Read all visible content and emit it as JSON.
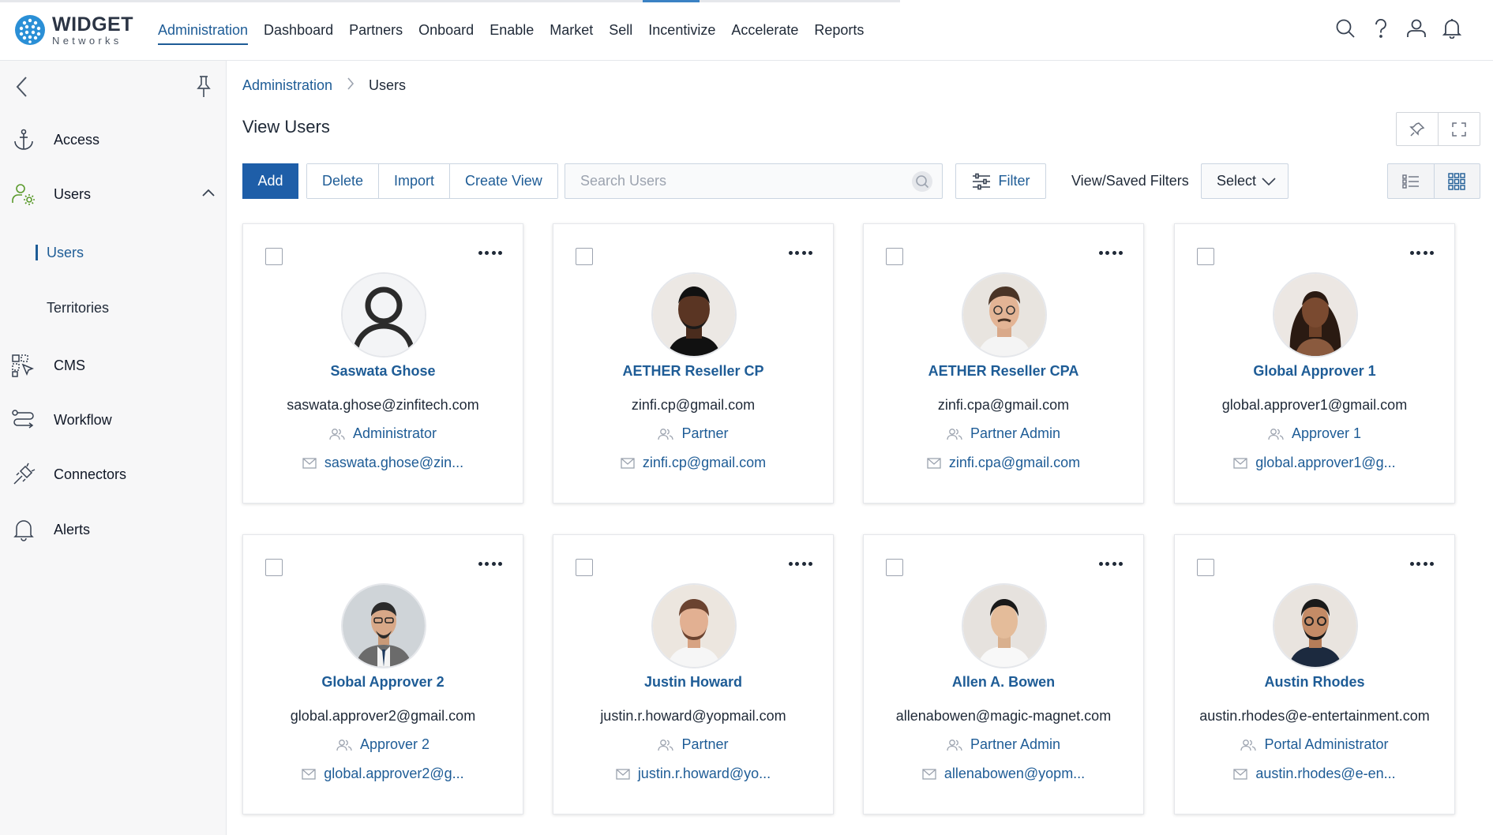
{
  "app": {
    "logo_line1": "WIDGET",
    "logo_line2": "Networks"
  },
  "nav": {
    "items": [
      {
        "label": "Administration",
        "active": true
      },
      {
        "label": "Dashboard"
      },
      {
        "label": "Partners"
      },
      {
        "label": "Onboard"
      },
      {
        "label": "Enable"
      },
      {
        "label": "Market"
      },
      {
        "label": "Sell"
      },
      {
        "label": "Incentivize"
      },
      {
        "label": "Accelerate"
      },
      {
        "label": "Reports"
      }
    ],
    "icons": [
      "search-icon",
      "help-icon",
      "user-profile-icon",
      "notifications-bell-icon"
    ]
  },
  "sidebar": {
    "items": [
      {
        "label": "Access",
        "icon": "anchor-icon"
      },
      {
        "label": "Users",
        "icon": "users-gear-icon",
        "expanded": true
      },
      {
        "label": "CMS",
        "icon": "cms-icon"
      },
      {
        "label": "Workflow",
        "icon": "workflow-icon"
      },
      {
        "label": "Connectors",
        "icon": "connectors-icon"
      },
      {
        "label": "Alerts",
        "icon": "bell-icon"
      }
    ],
    "subitems": [
      {
        "label": "Users",
        "active": true
      },
      {
        "label": "Territories"
      }
    ]
  },
  "breadcrumb": {
    "parent": "Administration",
    "current": "Users"
  },
  "page": {
    "title": "View Users"
  },
  "toolbar": {
    "add_label": "Add",
    "delete_label": "Delete",
    "import_label": "Import",
    "create_view_label": "Create View",
    "search_placeholder": "Search Users",
    "filter_label": "Filter",
    "saved_filters_label": "View/Saved Filters",
    "select_value": "Select"
  },
  "colors": {
    "accent": "#1e5c96",
    "primary_button": "#1e5ea8",
    "sidebar_bg": "#f7f7f8"
  },
  "users": [
    {
      "name": "Saswata Ghose",
      "email": "saswata.ghose@zinfitech.com",
      "role": "Administrator",
      "email_short": "saswata.ghose@zin...",
      "avatar": "placeholder"
    },
    {
      "name": "AETHER Reseller CP",
      "email": "zinfi.cp@gmail.com",
      "role": "Partner",
      "email_short": "zinfi.cp@gmail.com",
      "avatar": "dark-skin-man"
    },
    {
      "name": "AETHER Reseller CPA",
      "email": "zinfi.cpa@gmail.com",
      "role": "Partner Admin",
      "email_short": "zinfi.cpa@gmail.com",
      "avatar": "man-glasses-mustache"
    },
    {
      "name": "Global Approver 1",
      "email": "global.approver1@gmail.com",
      "role": "Approver 1",
      "email_short": "global.approver1@g...",
      "avatar": "dark-skin-woman"
    },
    {
      "name": "Global Approver 2",
      "email": "global.approver2@gmail.com",
      "role": "Approver 2",
      "email_short": "global.approver2@g...",
      "avatar": "illustrated-man-suit"
    },
    {
      "name": "Justin Howard",
      "email": "justin.r.howard@yopmail.com",
      "role": "Partner",
      "email_short": "justin.r.howard@yo...",
      "avatar": "bearded-man"
    },
    {
      "name": "Allen A. Bowen",
      "email": "allenabowen@magic-magnet.com",
      "role": "Partner Admin",
      "email_short": "allenabowen@yopm...",
      "avatar": "young-man"
    },
    {
      "name": "Austin Rhodes",
      "email": "austin.rhodes@e-entertainment.com",
      "role": "Portal Administrator",
      "email_short": "austin.rhodes@e-en...",
      "avatar": "man-glasses-beard"
    }
  ]
}
